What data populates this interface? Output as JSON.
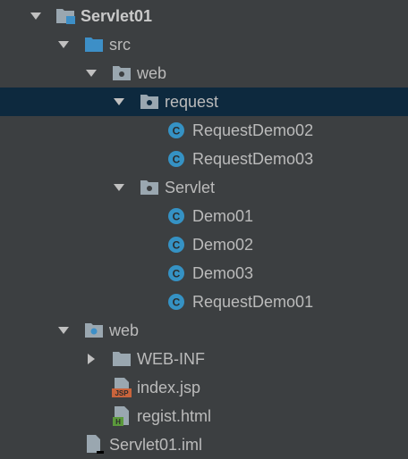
{
  "tree": {
    "project": "Servlet01",
    "src": "src",
    "src_web": "web",
    "request": "request",
    "request_demo02": "RequestDemo02",
    "request_demo03": "RequestDemo03",
    "servlet": "Servlet",
    "demo01": "Demo01",
    "demo02": "Demo02",
    "demo03": "Demo03",
    "request_demo01": "RequestDemo01",
    "web": "web",
    "web_inf": "WEB-INF",
    "index_jsp": "index.jsp",
    "regist_html": "regist.html",
    "iml": "Servlet01.iml"
  },
  "icons": {
    "class_badge": "C",
    "jsp_badge": "JSP",
    "html_badge": "H"
  },
  "colors": {
    "background": "#3c3f41",
    "selection": "#0d293e",
    "text": "#bbbbbb",
    "folder_blue": "#3d8fc7",
    "folder_gray": "#9aa7b0",
    "class_icon": "#3592c4"
  }
}
